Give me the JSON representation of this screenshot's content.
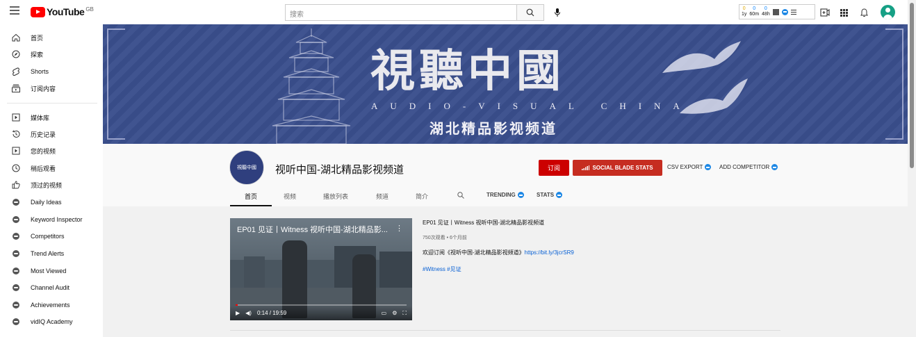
{
  "header": {
    "logo_text": "YouTube",
    "region": "GB",
    "search_placeholder": "搜索",
    "vidiq_stats": {
      "counts": [
        "0",
        "0",
        "0"
      ],
      "periods": [
        "1y",
        "60m",
        "48h"
      ]
    }
  },
  "sidebar": {
    "items": [
      {
        "label": "首页",
        "icon": "home-icon"
      },
      {
        "label": "探索",
        "icon": "explore-icon"
      },
      {
        "label": "Shorts",
        "icon": "shorts-icon"
      },
      {
        "label": "订阅内容",
        "icon": "subscriptions-icon"
      },
      {
        "label": "媒体库",
        "icon": "library-icon"
      },
      {
        "label": "历史记录",
        "icon": "history-icon"
      },
      {
        "label": "您的视频",
        "icon": "your-videos-icon"
      },
      {
        "label": "稍后观看",
        "icon": "watch-later-icon"
      },
      {
        "label": "顶过的视频",
        "icon": "liked-videos-icon"
      },
      {
        "label": "Daily Ideas",
        "icon": "vidiq-icon"
      },
      {
        "label": "Keyword Inspector",
        "icon": "vidiq-icon"
      },
      {
        "label": "Competitors",
        "icon": "vidiq-icon"
      },
      {
        "label": "Trend Alerts",
        "icon": "vidiq-icon"
      },
      {
        "label": "Most Viewed",
        "icon": "vidiq-icon"
      },
      {
        "label": "Channel Audit",
        "icon": "vidiq-icon"
      },
      {
        "label": "Achievements",
        "icon": "vidiq-icon"
      },
      {
        "label": "vidIQ Academy",
        "icon": "vidiq-icon"
      }
    ]
  },
  "banner": {
    "title": "視聽中國",
    "subtitle_en": "AUDIO-VISUAL CHINA",
    "subtitle_cn": "湖北精品影视频道",
    "background_color": "#3a4e8c"
  },
  "channel": {
    "avatar_text": "視聽中國",
    "name": "视听中国-湖北精品影视频道",
    "subscribe_label": "订阅",
    "socialblade_label": "SOCIAL BLADE STATS",
    "csv_label": "CSV EXPORT",
    "competitor_label": "ADD COMPETITOR"
  },
  "tabs": [
    {
      "label": "首页",
      "active": true
    },
    {
      "label": "视频"
    },
    {
      "label": "播放列表"
    },
    {
      "label": "频道"
    },
    {
      "label": "简介"
    },
    {
      "label": "TRENDING"
    },
    {
      "label": "STATS"
    }
  ],
  "video": {
    "overlay_title": "EP01 见证丨Witness 视听中国-湖北精品影...",
    "time": "0:14 / 19:59",
    "progress": 0.012,
    "title": "EP01 见证丨Witness 视听中国-湖北精品影视频道",
    "meta": "750次观看 • 6个月前",
    "desc_text": "欢迎订阅《视听中国-湖北精品影视频道》",
    "desc_link": "https://bit.ly/3jcrSR9",
    "tags": "#Witness #见证"
  },
  "colors": {
    "accent_red": "#cc0000",
    "socialblade_red": "#c62d21",
    "link_blue": "#065fd4",
    "vidiq_blue": "#1e88e5"
  }
}
